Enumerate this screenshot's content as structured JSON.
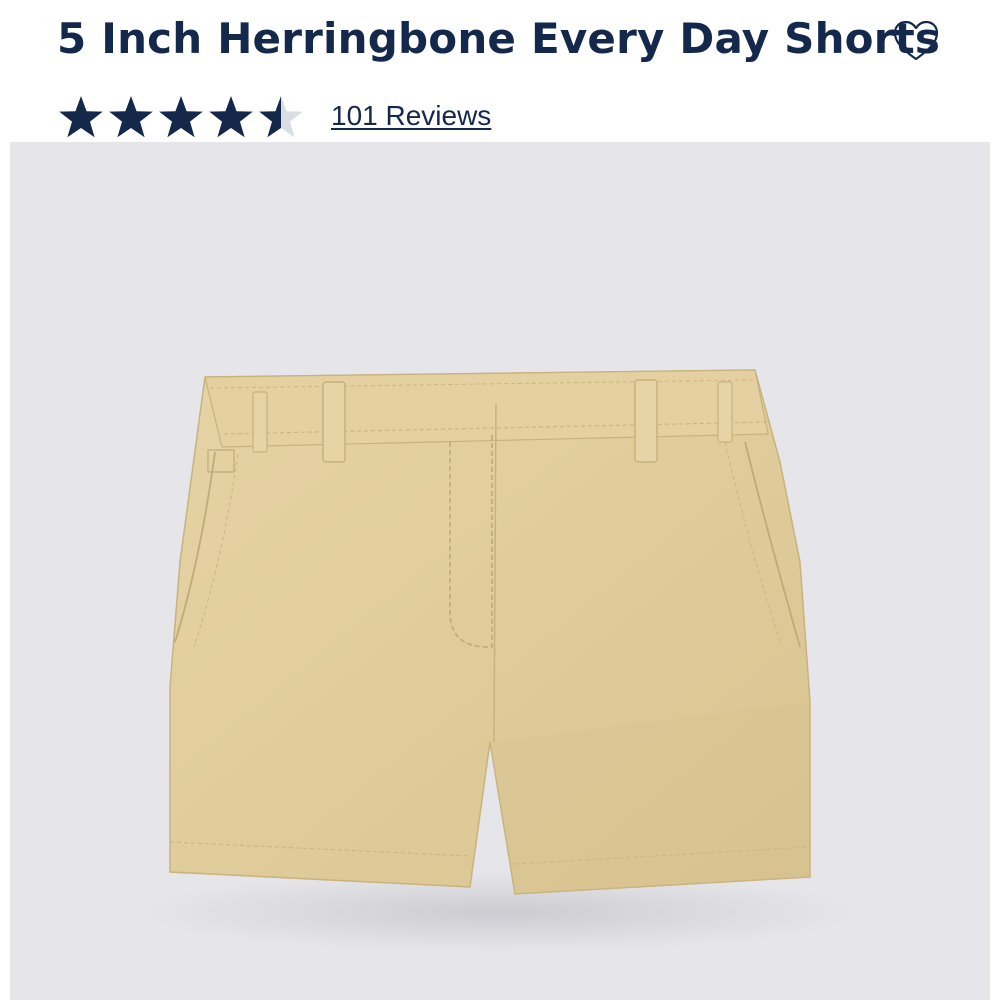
{
  "product": {
    "title": "5 Inch Herringbone Every Day Shorts",
    "rating_value": 4.5,
    "rating_max": 5,
    "reviews_label": "101 Reviews"
  },
  "icons": {
    "wishlist": "heart-outline-icon",
    "rating_star": "star-icon"
  },
  "colors": {
    "brand_navy": "#14284b",
    "star_empty": "#d9dde4",
    "image_background": "#e6e6ea",
    "shorts_khaki": "#e2cd9c"
  }
}
